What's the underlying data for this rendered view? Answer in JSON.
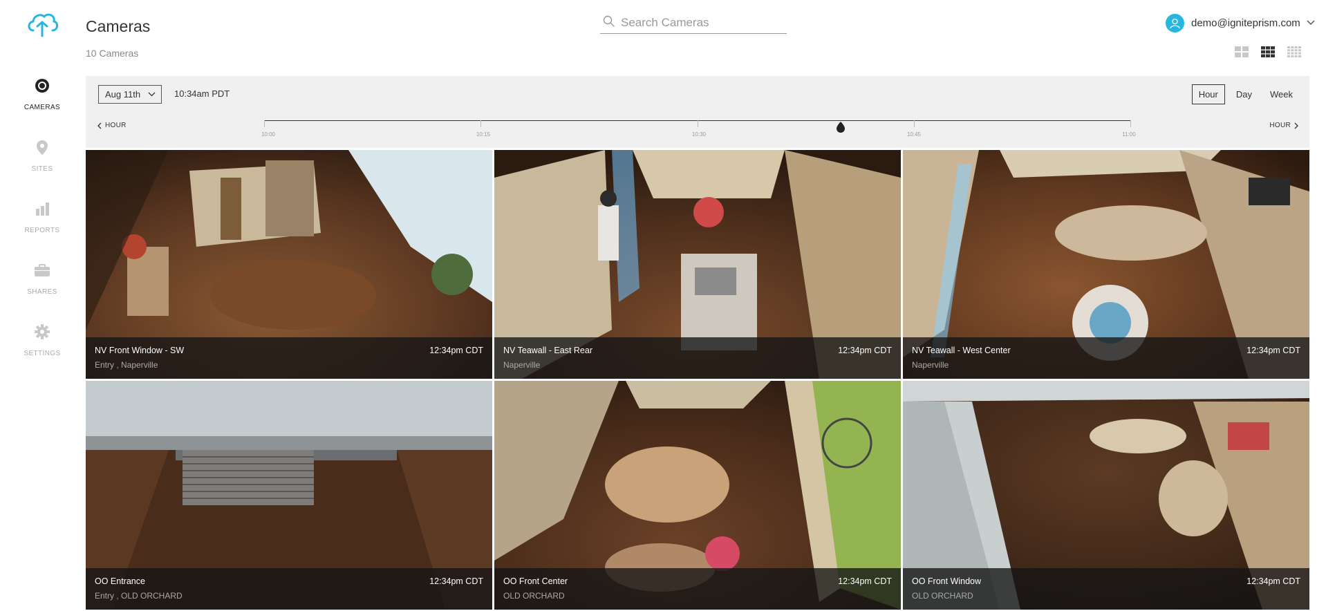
{
  "app": {
    "logo": "cloud-logo-icon",
    "accent": "#27b6e0"
  },
  "sidebar": {
    "items": [
      {
        "label": "CAMERAS",
        "icon": "camera-icon",
        "active": true
      },
      {
        "label": "SITES",
        "icon": "map-pin-icon",
        "active": false
      },
      {
        "label": "REPORTS",
        "icon": "bar-chart-icon",
        "active": false
      },
      {
        "label": "SHARES",
        "icon": "briefcase-icon",
        "active": false
      },
      {
        "label": "SETTINGS",
        "icon": "gear-icon",
        "active": false
      }
    ]
  },
  "header": {
    "title": "Cameras",
    "count": "10 Cameras",
    "search_placeholder": "Search Cameras",
    "user_email": "demo@igniteprism.com",
    "layouts": [
      "grid-2x2-icon",
      "grid-3x3-icon",
      "grid-4x4-icon"
    ],
    "active_layout": "grid-3x3-icon"
  },
  "timeline": {
    "date": "Aug 11th",
    "time": "10:34am PDT",
    "ranges": [
      "Hour",
      "Day",
      "Week"
    ],
    "active_range": "Hour",
    "prev_label": "HOUR",
    "next_label": "HOUR",
    "ticks": [
      "10:00",
      "10:15",
      "10:30",
      "10:45",
      "11:00"
    ],
    "playhead_time": "10:34"
  },
  "cameras": [
    {
      "name": "NV Front Window - SW",
      "time": "12:34pm CDT",
      "location": "Entry , Naperville"
    },
    {
      "name": "NV Teawall - East Rear",
      "time": "12:34pm CDT",
      "location": "Naperville"
    },
    {
      "name": "NV Teawall - West Center",
      "time": "12:34pm CDT",
      "location": "Naperville"
    },
    {
      "name": "OO Entrance",
      "time": "12:34pm CDT",
      "location": "Entry , OLD ORCHARD"
    },
    {
      "name": "OO Front Center",
      "time": "12:34pm CDT",
      "location": "OLD ORCHARD"
    },
    {
      "name": "OO Front Window",
      "time": "12:34pm CDT",
      "location": "OLD ORCHARD"
    }
  ]
}
